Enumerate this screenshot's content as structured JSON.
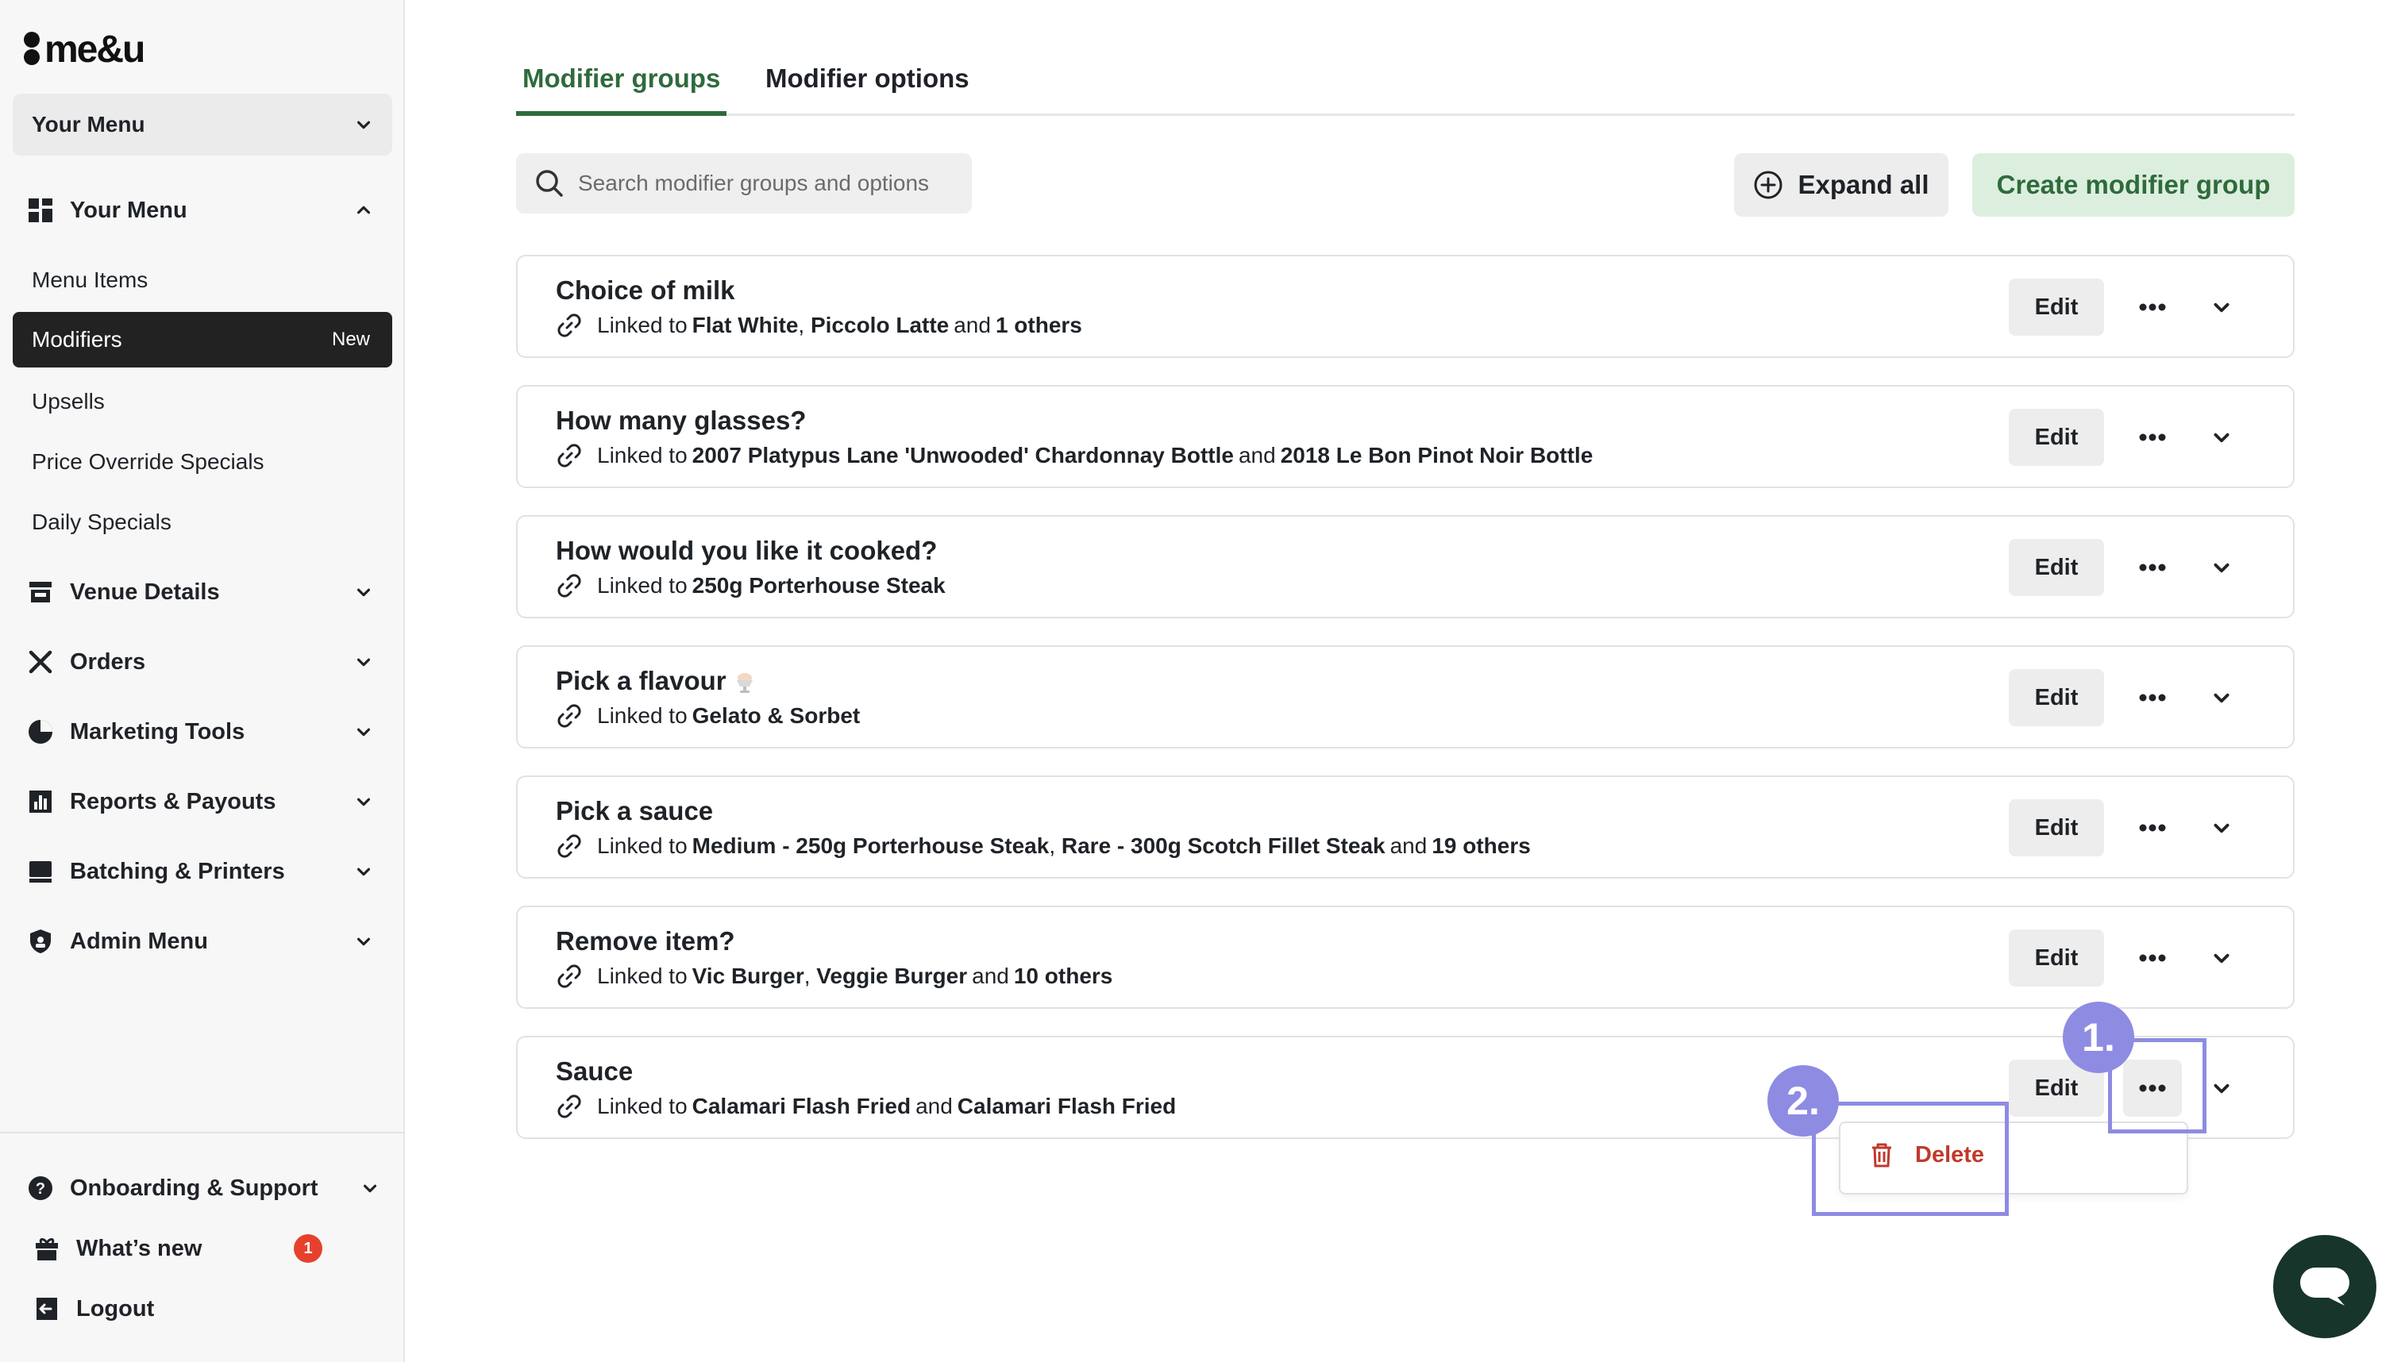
{
  "brand": {
    "logo_text": "me&u"
  },
  "sidebar": {
    "menu_select": "Your Menu",
    "your_menu_section": "Your Menu",
    "sub_items": [
      {
        "label": "Menu Items"
      },
      {
        "label": "Modifiers",
        "badge": "New",
        "active": true
      },
      {
        "label": "Upsells"
      },
      {
        "label": "Price Override Specials"
      },
      {
        "label": "Daily Specials"
      }
    ],
    "sections": [
      {
        "label": "Venue Details",
        "icon": "storefront-icon"
      },
      {
        "label": "Orders",
        "icon": "utensils-icon"
      },
      {
        "label": "Marketing Tools",
        "icon": "pie-chart-icon"
      },
      {
        "label": "Reports & Payouts",
        "icon": "bar-chart-icon"
      },
      {
        "label": "Batching & Printers",
        "icon": "printer-icon"
      },
      {
        "label": "Admin Menu",
        "icon": "shield-icon"
      }
    ],
    "footer": {
      "support": "Onboarding & Support",
      "whats_new": "What’s new",
      "whats_new_count": "1",
      "logout": "Logout"
    }
  },
  "tabs": {
    "active": "Modifier groups",
    "inactive": "Modifier options"
  },
  "search": {
    "placeholder": "Search modifier groups and options"
  },
  "toolbar": {
    "expand_all": "Expand all",
    "create": "Create modifier group"
  },
  "groups": [
    {
      "title": "Choice of milk",
      "prefix": "Linked to",
      "items": [
        "Flat White",
        "Piccolo Latte"
      ],
      "joiner": "and",
      "tail": "1 others"
    },
    {
      "title": "How many glasses?",
      "prefix": "Linked to",
      "items": [
        "2007 Platypus Lane 'Unwooded' Chardonnay Bottle"
      ],
      "joiner": "and",
      "tail": "2018 Le Bon Pinot Noir Bottle"
    },
    {
      "title": "How would you like it cooked?",
      "prefix": "Linked to",
      "items": [
        "250g Porterhouse Steak"
      ],
      "joiner": "",
      "tail": ""
    },
    {
      "title": "Pick a flavour",
      "prefix": "Linked to",
      "items": [
        "Gelato & Sorbet"
      ],
      "joiner": "",
      "tail": ""
    },
    {
      "title": "Pick a sauce",
      "prefix": "Linked to",
      "items": [
        "Medium - 250g Porterhouse Steak",
        "Rare - 300g Scotch Fillet Steak"
      ],
      "joiner": "and",
      "tail": "19 others"
    },
    {
      "title": "Remove item?",
      "prefix": "Linked to",
      "items": [
        "Vic Burger",
        "Veggie Burger"
      ],
      "joiner": "and",
      "tail": "10 others"
    },
    {
      "title": "Sauce",
      "prefix": "Linked to",
      "items": [
        "Calamari Flash Fried"
      ],
      "joiner": "and",
      "tail": "Calamari Flash Fried"
    }
  ],
  "row_actions": {
    "edit": "Edit"
  },
  "dropdown": {
    "delete": "Delete"
  },
  "annotations": {
    "step1": "1.",
    "step2": "2."
  },
  "colors": {
    "accent_green": "#2f6b3c",
    "create_bg": "#dcefdf",
    "delete_red": "#c0392b",
    "annotation_purple": "#8e8be2",
    "chat_bg": "#17352a"
  }
}
